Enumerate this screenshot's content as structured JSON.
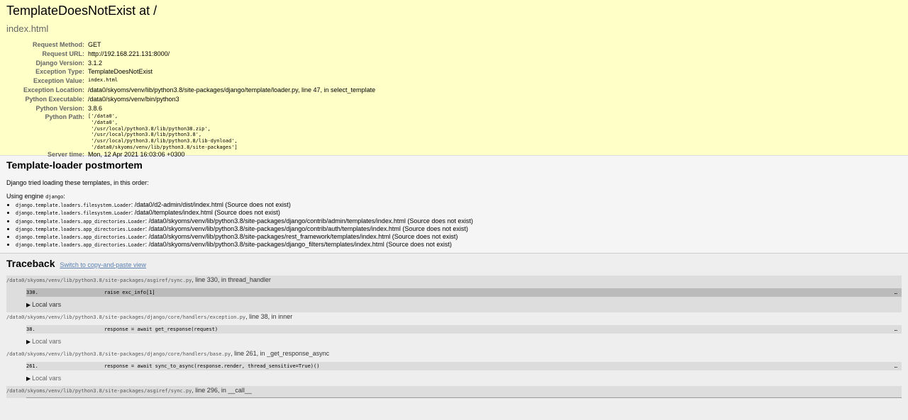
{
  "summary": {
    "title": "TemplateDoesNotExist at /",
    "exception_value_heading": "index.html",
    "rows": [
      {
        "label": "Request Method:",
        "value": "GET"
      },
      {
        "label": "Request URL:",
        "value": "http://192.168.221.131:8000/"
      },
      {
        "label": "Django Version:",
        "value": "3.1.2"
      },
      {
        "label": "Exception Type:",
        "value": "TemplateDoesNotExist"
      },
      {
        "label": "Exception Value:",
        "value": "index.html"
      },
      {
        "label": "Exception Location:",
        "value": "/data0/skyoms/venv/lib/python3.8/site-packages/django/template/loader.py, line 47, in select_template"
      },
      {
        "label": "Python Executable:",
        "value": "/data0/skyoms/venv/bin/python3"
      },
      {
        "label": "Python Version:",
        "value": "3.8.6"
      },
      {
        "label": "Python Path:",
        "value": "['/data0',\n '/data0',\n '/usr/local/python3.8/lib/python38.zip',\n '/usr/local/python3.8/lib/python3.8',\n '/usr/local/python3.8/lib/python3.8/lib-dynload',\n '/data0/skyoms/venv/lib/python3.8/site-packages']"
      },
      {
        "label": "Server time:",
        "value": "Mon, 12 Apr 2021 16:03:06 +0300"
      }
    ]
  },
  "postmortem": {
    "heading": "Template-loader postmortem",
    "intro": "Django tried loading these templates, in this order:",
    "engine_label": "Using engine",
    "engine_name": "django",
    "engine_colon": ":",
    "items": [
      {
        "loader": "django.template.loaders.filesystem.Loader",
        "text": ": /data0/d2-admin/dist/index.html (Source does not exist)"
      },
      {
        "loader": "django.template.loaders.filesystem.Loader",
        "text": ": /data0/templates/index.html (Source does not exist)"
      },
      {
        "loader": "django.template.loaders.app_directories.Loader",
        "text": ": /data0/skyoms/venv/lib/python3.8/site-packages/django/contrib/admin/templates/index.html (Source does not exist)"
      },
      {
        "loader": "django.template.loaders.app_directories.Loader",
        "text": ": /data0/skyoms/venv/lib/python3.8/site-packages/django/contrib/auth/templates/index.html (Source does not exist)"
      },
      {
        "loader": "django.template.loaders.app_directories.Loader",
        "text": ": /data0/skyoms/venv/lib/python3.8/site-packages/rest_framework/templates/index.html (Source does not exist)"
      },
      {
        "loader": "django.template.loaders.app_directories.Loader",
        "text": ": /data0/skyoms/venv/lib/python3.8/site-packages/django_filters/templates/index.html (Source does not exist)"
      }
    ]
  },
  "traceback": {
    "heading": "Traceback",
    "switch_link": "Switch to copy-and-paste view",
    "local_vars_label": "Local vars",
    "ellipsis": "…",
    "frames": [
      {
        "file": "/data0/skyoms/venv/lib/python3.8/site-packages/asgiref/sync.py",
        "suffix": ", line 330, in thread_handler",
        "lineno": "330.",
        "code": "raise exc_info[1]"
      },
      {
        "file": "/data0/skyoms/venv/lib/python3.8/site-packages/django/core/handlers/exception.py",
        "suffix": ", line 38, in inner",
        "lineno": "38.",
        "code": "response = await get_response(request)"
      },
      {
        "file": "/data0/skyoms/venv/lib/python3.8/site-packages/django/core/handlers/base.py",
        "suffix": ", line 261, in _get_response_async",
        "lineno": "261.",
        "code": "response = await sync_to_async(response.render, thread_sensitive=True)()"
      },
      {
        "file": "/data0/skyoms/venv/lib/python3.8/site-packages/asgiref/sync.py",
        "suffix": ", line 296, in __call__"
      }
    ]
  }
}
